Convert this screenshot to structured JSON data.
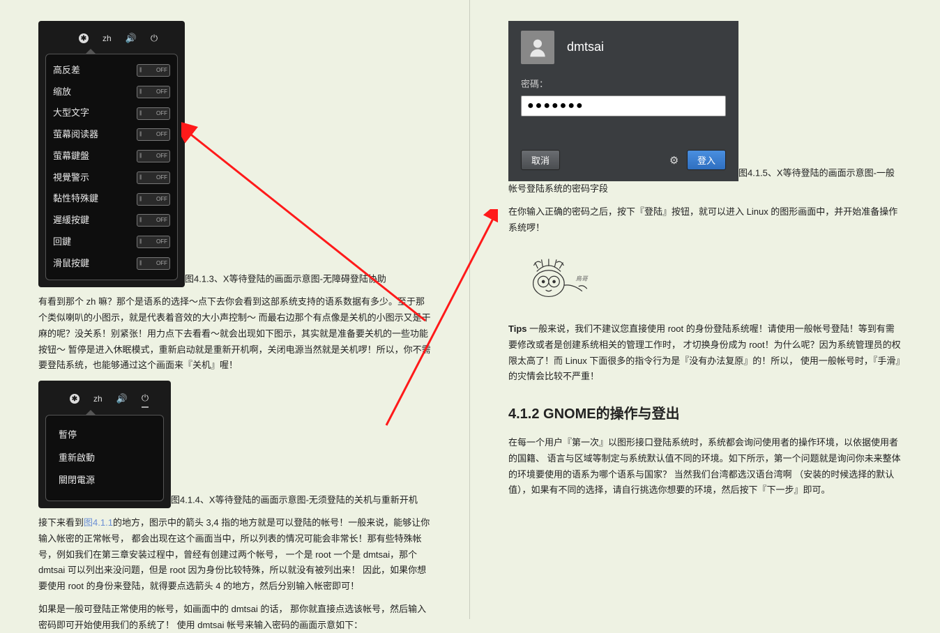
{
  "left": {
    "fig413": {
      "topbar_lang": "zh",
      "toggles": [
        {
          "label": "高反差",
          "state": "OFF"
        },
        {
          "label": "缩放",
          "state": "OFF"
        },
        {
          "label": "大型文字",
          "state": "OFF"
        },
        {
          "label": "萤幕阅读器",
          "state": "OFF"
        },
        {
          "label": "萤幕鍵盤",
          "state": "OFF"
        },
        {
          "label": "視覺警示",
          "state": "OFF"
        },
        {
          "label": "黏性特殊鍵",
          "state": "OFF"
        },
        {
          "label": "遲緩按鍵",
          "state": "OFF"
        },
        {
          "label": "回鍵",
          "state": "OFF"
        },
        {
          "label": "滑鼠按鍵",
          "state": "OFF"
        }
      ],
      "caption": "图4.1.3、X等待登陆的画面示意图-无障碍登陆协助"
    },
    "para1": "有看到那个 zh 嘛？那个是语系的选择～点下去你会看到这部系统支持的语系数据有多少。至于那个类似喇叭的小图示，就是代表着音效的大小声控制～ 而最右边那个有点像是关机的小图示又是干麻的呢？没关系！别紧张！用力点下去看看～就会出现如下图示，其实就是准备要关机的一些功能按钮～ 暂停是进入休眠模式，重新启动就是重新开机啊，关闭电源当然就是关机啰！所以，你不需要登陆系统，也能够通过这个画面来『关机』喔！",
    "fig414": {
      "topbar_lang": "zh",
      "menu": [
        "暫停",
        "重新啟動",
        "關閉電源"
      ],
      "caption": "图4.1.4、X等待登陆的画面示意图-无须登陆的关机与重新开机"
    },
    "para2_pre": "接下来看到",
    "para2_link": "图4.1.1",
    "para2_post": "的地方，图示中的箭头 3,4 指的地方就是可以登陆的帐号！一般来说，能够让你输入帐密的正常帐号， 都会出现在这个画面当中，所以列表的情况可能会非常长！那有些特殊帐号，例如我们在第三章安装过程中，曾经有创建过两个帐号， 一个是 root 一个是 dmtsai，那个 dmtsai 可以列出来没问题，但是 root 因为身份比较特殊，所以就没有被列出来！ 因此，如果你想要使用 root 的身份来登陆，就得要点选箭头 4 的地方，然后分别输入帐密即可！",
    "para3": "如果是一般可登陆正常使用的帐号，如画面中的 dmtsai 的话， 那你就直接点选该帐号，然后输入密码即可开始使用我们的系统了！ 使用 dmtsai 帐号来输入密码的画面示意如下："
  },
  "right": {
    "login": {
      "username": "dmtsai",
      "pwd_label": "密碼：",
      "pwd_value": "●●●●●●●",
      "cancel": "取消",
      "signin": "登入"
    },
    "fig415_caption": "图4.1.5、X等待登陆的画面示意图-一般帐号登陆系统的密码字段",
    "para4": "在你输入正确的密码之后，按下『登陆』按钮，就可以进入 Linux 的图形画面中，并开始准备操作系统啰！",
    "vbird_sig": "鳥哥",
    "tips_label": "Tips",
    "tips_body": " 一般来说，我们不建议您直接使用 root 的身份登陆系统喔！请使用一般帐号登陆！等到有需要修改或者是创建系统相关的管理工作时， 才切换身份成为 root！为什么呢？因为系统管理员的权限太高了！而 Linux 下面很多的指令行为是『没有办法复原』的！所以， 使用一般帐号时，『手滑』的灾情会比较不严重！",
    "heading": "4.1.2 GNOME的操作与登出",
    "para5": "在每一个用户『第一次』以图形接口登陆系统时，系统都会询问使用者的操作环境，以依据使用者的国籍、 语言与区域等制定与系统默认值不同的环境。如下所示，第一个问题就是询问你未来整体的环境要使用的语系为哪个语系与国家？ 当然我们台湾都选汉语台湾啊 （安装的时候选择的默认值），如果有不同的选择，请自行挑选你想要的环境，然后按下『下一步』即可。"
  }
}
